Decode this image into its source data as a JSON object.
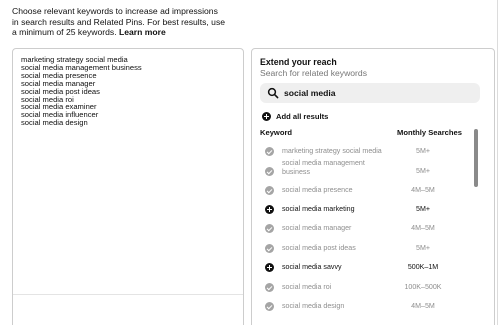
{
  "intro": {
    "line1": "Choose relevant keywords to increase ad impressions",
    "line2": "in search results and Related Pins. For best results, use",
    "line3_prefix": "a minimum of 25 keywords.",
    "learn_more": "Learn more"
  },
  "selected_keywords": [
    "marketing strategy social media",
    "social media management business",
    "social media presence",
    "social media manager",
    "social media post ideas",
    "social media roi",
    "social media examiner",
    "social media influencer",
    "social media design"
  ],
  "reach": {
    "title": "Extend your reach",
    "subtitle": "Search for related keywords",
    "search_value": "social media",
    "add_all_label": "Add all results",
    "col_keyword": "Keyword",
    "col_searches": "Monthly Searches",
    "rows": [
      {
        "keyword": "marketing strategy social media",
        "searches": "5M+",
        "state": "added"
      },
      {
        "keyword": "social media management business",
        "searches": "5M+",
        "state": "added"
      },
      {
        "keyword": "social media presence",
        "searches": "4M–5M",
        "state": "added"
      },
      {
        "keyword": "social media marketing",
        "searches": "5M+",
        "state": "available"
      },
      {
        "keyword": "social media manager",
        "searches": "4M–5M",
        "state": "added"
      },
      {
        "keyword": "social media post ideas",
        "searches": "5M+",
        "state": "added"
      },
      {
        "keyword": "social media savvy",
        "searches": "500K–1M",
        "state": "available"
      },
      {
        "keyword": "social media roi",
        "searches": "100K–500K",
        "state": "added"
      },
      {
        "keyword": "social media design",
        "searches": "4M–5M",
        "state": "added"
      }
    ]
  },
  "colors": {
    "added_icon": "#a5a5a5",
    "available_icon": "#111111",
    "muted_text": "#8e8e8e",
    "search_bg": "#efefef"
  },
  "icons": {
    "search": "search-icon",
    "add": "plus-circle-icon",
    "added": "check-circle-icon"
  }
}
